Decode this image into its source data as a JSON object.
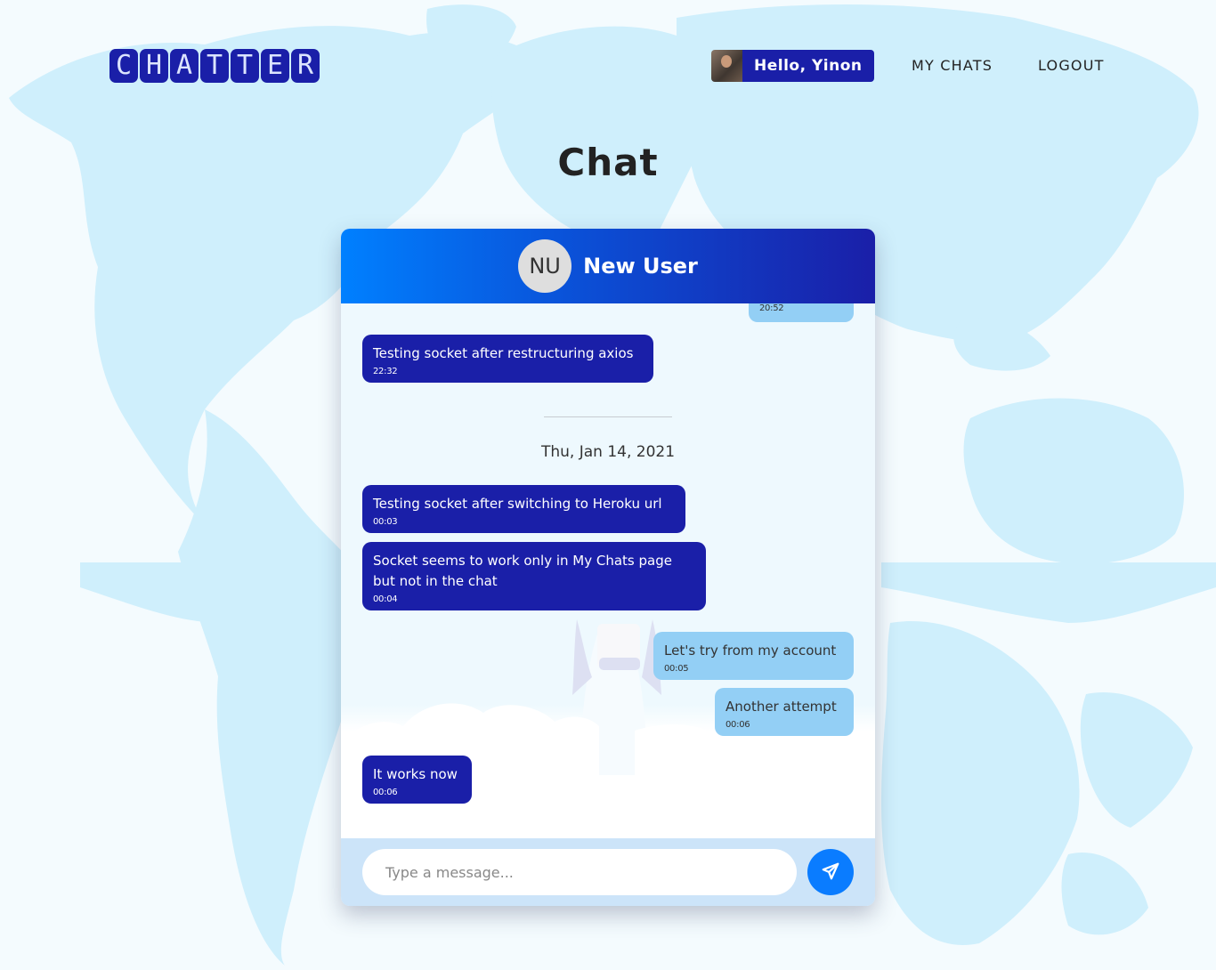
{
  "brand": {
    "logo_letters": [
      "C",
      "H",
      "A",
      "T",
      "T",
      "E",
      "R"
    ],
    "name": "CHATTER"
  },
  "nav": {
    "greeting": "Hello, Yinon",
    "my_chats": "MY CHATS",
    "logout": "LOGOUT"
  },
  "page": {
    "title": "Chat"
  },
  "chat": {
    "contact_initials": "NU",
    "contact_name": "New User",
    "messages": [
      {
        "direction": "out",
        "text": "",
        "time": "20:52"
      },
      {
        "direction": "in",
        "text": "Testing socket after restructuring axios",
        "time": "22:32"
      },
      {
        "direction": "in",
        "text": "Testing socket after switching to Heroku url",
        "time": "00:03"
      },
      {
        "direction": "in",
        "text": "Socket seems to work only in My Chats page but not in the chat",
        "time": "00:04"
      },
      {
        "direction": "out",
        "text": "Let's try from my account",
        "time": "00:05"
      },
      {
        "direction": "out",
        "text": "Another attempt",
        "time": "00:06"
      },
      {
        "direction": "in",
        "text": "It works now",
        "time": "00:06"
      }
    ],
    "date_separator": "Thu, Jan 14, 2021",
    "composer": {
      "placeholder": "Type a message...",
      "value": ""
    },
    "send_icon": "paper-plane-icon"
  },
  "colors": {
    "brand_blue": "#1a1fa8",
    "accent_blue": "#0a7cff",
    "outgoing_bubble": "#93cff5",
    "composer_bg": "#cce4f9",
    "map_land": "#cfeffc"
  }
}
